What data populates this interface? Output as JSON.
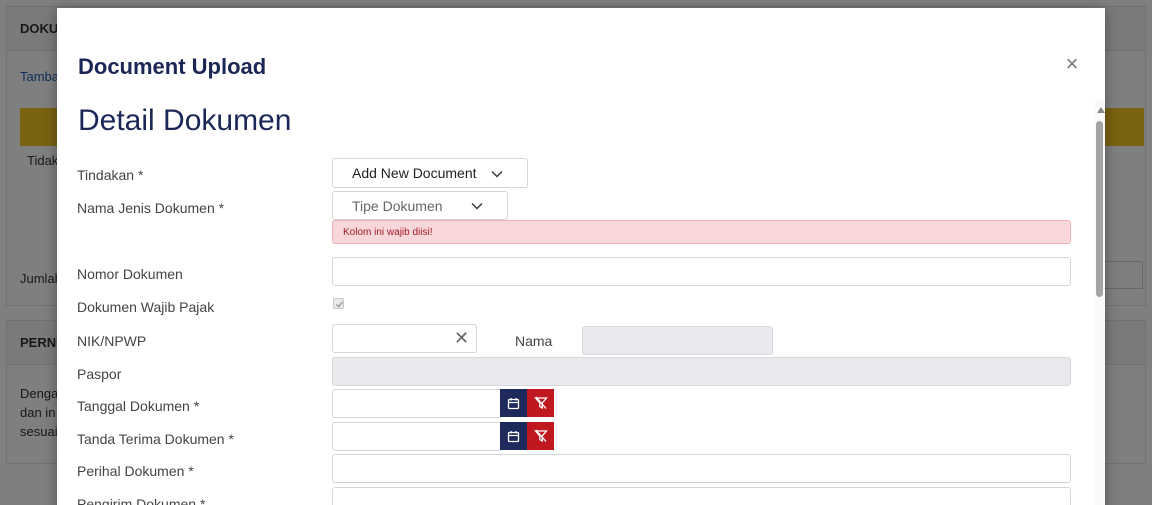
{
  "background": {
    "card1_header": "DOKU",
    "link": "Tamba",
    "text_tidak": "Tidak",
    "text_jumlah": "Jumlah",
    "card2_header": "PERNY",
    "para_line1": "Denga",
    "para_line2": "dan in",
    "para_line3": "sesuai"
  },
  "modal": {
    "title": "Document Upload",
    "close_symbol": "×",
    "section_title": "Detail Dokumen"
  },
  "form": {
    "tindakan_label": "Tindakan *",
    "tindakan_value": "Add New Document",
    "jenis_label": "Nama Jenis Dokumen *",
    "jenis_placeholder": "Tipe Dokumen",
    "error_text": "Kolom ini wajib diisi!",
    "nomor_label": "Nomor Dokumen",
    "wajib_pajak_label": "Dokumen Wajib Pajak",
    "wajib_pajak_checked": true,
    "nik_label": "NIK/NPWP",
    "clear_symbol": "✕",
    "nama_label": "Nama",
    "paspor_label": "Paspor",
    "tanggal_label": "Tanggal Dokumen *",
    "tanda_terima_label": "Tanda Terima Dokumen *",
    "perihal_label": "Perihal Dokumen *",
    "pengirim_label": "Pengirim Dokumen *"
  },
  "icons": {
    "calendar": "calendar-icon",
    "filter_clear": "filter-clear-icon",
    "chevron": "chevron-down-icon",
    "close": "close-icon"
  },
  "colors": {
    "title": "#1b2757",
    "calendar_button": "#1f2a5c",
    "clear_button": "#c0181f",
    "error_bg": "#f8d7da",
    "error_text": "#a11a2a",
    "accent_yellow": "#f3c623"
  }
}
